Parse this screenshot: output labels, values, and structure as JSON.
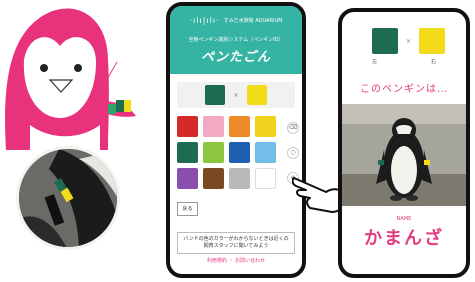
{
  "phone1": {
    "brand_mark": "·ılı|ılı·",
    "brand_text": "すみだ水族館 AQUARIUM",
    "subtitle": "全館ペンギン識別システム（ペンギンID）",
    "logo": "ペンたごん",
    "times": "×",
    "selected": [
      "#1d6b52",
      "#f2dc1a"
    ],
    "palette": [
      "#d42a2a",
      "#f3a8c3",
      "#ee8a2a",
      "#f0d21c",
      "#1d6b52",
      "#8cc63f",
      "#1f5fb0",
      "#73bde9",
      "#8a4fae",
      "#7a4a22",
      "#b9b9b9",
      "#ffffff"
    ],
    "side_buttons": [
      "⌫",
      "○",
      "≡"
    ],
    "back_label": "戻る",
    "note": "バンドの色のカラーがわからないときは近くの飼育スタッフに聞いてみよう",
    "footer": "利用規約  ・  お問い合わせ"
  },
  "phone2": {
    "swatches": [
      "#1d6b52",
      "#f2dc1a"
    ],
    "times": "×",
    "label_left": "左",
    "label_right": "右",
    "title": "このペンギンは…",
    "small_label": "NAME",
    "name": "かまんざ"
  },
  "colors": {
    "accent_pink": "#e33c7f",
    "header_teal": "#35b3a3"
  }
}
